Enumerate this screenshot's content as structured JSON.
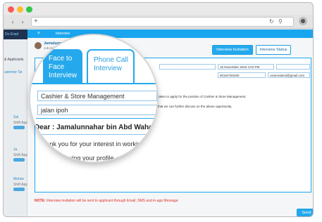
{
  "browser": {
    "url": ""
  },
  "app": {
    "brand": "Do Empl",
    "left_labels": [
      "& Applicants",
      "ustomer Se"
    ],
    "left_entries": [
      {
        "name": "Sal",
        "meta": "Shift App"
      },
      {
        "name": "Ja",
        "meta": "Shift App"
      },
      {
        "name": "Muhse",
        "meta": "Shift App"
      }
    ]
  },
  "modal": {
    "close_glyph": "×",
    "title": "Interview",
    "applicant": {
      "name": "Jamalunnahar bin Abd Wahab",
      "age": "22 years old",
      "job": "Job Applic"
    },
    "buttons": {
      "invitation": "Interview Invitation",
      "status": "Interview Status"
    },
    "tabs": {
      "face_to_face": "Face to Face Interview",
      "phone_call": "Phone Call Interview"
    },
    "fields": {
      "position": "Cashier & Store Management",
      "location": "jalan ipoh",
      "date": "15 November 2018 4:04 PM",
      "phone": "60164750200",
      "email": "ussersales3@gmail.com"
    },
    "letter": {
      "salutation": "Dear : Jamalunnahar bin Abd Wahab",
      "line_1": "Thank you for your interest in working w",
      "line_2": "After reviewing your profile, we w",
      "line_1_rest": "ve taken to apply for the position of Cashier & Store Management.",
      "line_2_rest": "so that we can further discuss on the above opportunity."
    },
    "note_label": "NOTE:",
    "note_text": "Interview invitation will be sent to applicant through Email, SMS and in-app Message",
    "send_button": "Send"
  },
  "colors": {
    "accent": "#1aa6ef",
    "dark_nav": "#1d3350",
    "note_red": "#e0312d"
  },
  "icons": [
    "back-icon",
    "forward-icon",
    "add-tab-icon",
    "reload-icon",
    "search-icon",
    "download-icon"
  ]
}
